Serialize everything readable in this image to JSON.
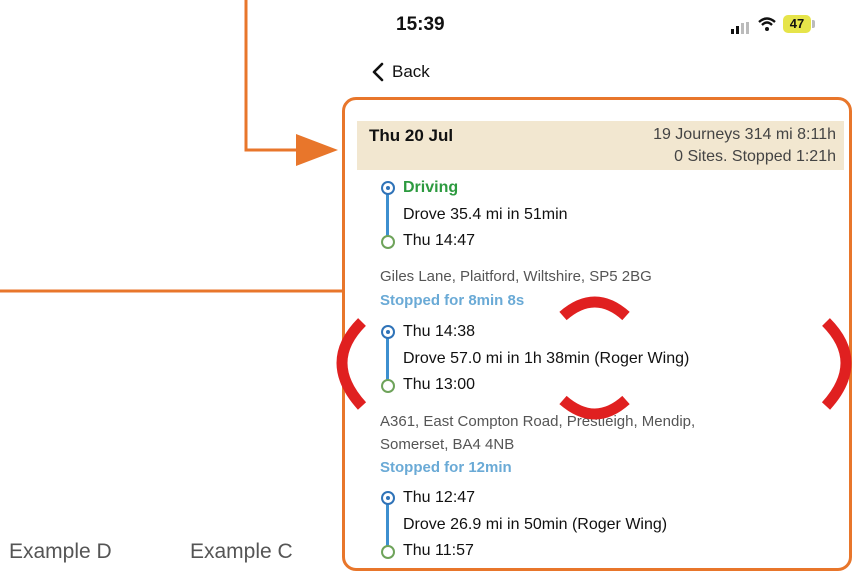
{
  "status_bar": {
    "time": "15:39",
    "battery": "47"
  },
  "nav": {
    "back_label": "Back"
  },
  "day": {
    "title": "Thu 20 Jul",
    "summary_line1": "19 Journeys 314 mi 8:11h",
    "summary_line2": "0 Sites. Stopped 1:21h"
  },
  "entries": [
    {
      "top": "Driving",
      "detail": "Drove 35.4 mi in 51min",
      "bottom": "Thu 14:47"
    },
    {
      "top": "Thu 14:38",
      "detail": "Drove 57.0 mi in 1h 38min (Roger Wing)",
      "bottom": "Thu 13:00"
    },
    {
      "top": "Thu 12:47",
      "detail": "Drove 26.9 mi in 50min (Roger Wing)",
      "bottom": "Thu 11:57"
    }
  ],
  "stops": [
    {
      "address": "Giles Lane, Plaitford, Wiltshire, SP5 2BG",
      "duration": "Stopped for 8min 8s"
    },
    {
      "address_line1": "A361, East Compton Road, Prestleigh, Mendip,",
      "address_line2": "Somerset, BA4 4NB",
      "duration": "Stopped for 12min"
    }
  ],
  "labels": {
    "example_d": "Example D",
    "example_c": "Example C"
  },
  "colors": {
    "annotation_orange": "#e8762b",
    "highlight_red": "#e02020",
    "driving_green": "#2c9a3f",
    "stop_blue": "#6aaad6"
  }
}
